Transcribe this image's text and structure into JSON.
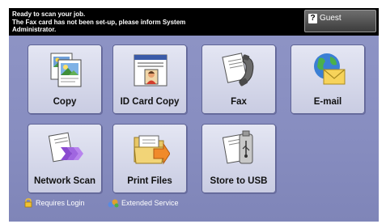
{
  "status": {
    "lines": [
      "Ready to scan your job.",
      "The Fax card has not been set-up, please inform System",
      "Administrator."
    ]
  },
  "user": {
    "icon": "question-mark-icon",
    "label": "Guest"
  },
  "services": [
    {
      "label": "Copy",
      "icon": "copy-icon"
    },
    {
      "label": "ID Card Copy",
      "icon": "id-card-icon"
    },
    {
      "label": "Fax",
      "icon": "fax-icon"
    },
    {
      "label": "E-mail",
      "icon": "email-globe-icon"
    },
    {
      "label": "Network Scan",
      "icon": "network-scan-icon"
    },
    {
      "label": "Print Files",
      "icon": "print-files-icon"
    },
    {
      "label": "Store to USB",
      "icon": "usb-icon"
    }
  ],
  "legend": {
    "requires_login": "Requires Login",
    "extended_service": "Extended Service"
  },
  "colors": {
    "background": "#878dc0",
    "statusbar": "#000000",
    "tile": "#d7d9eb"
  }
}
